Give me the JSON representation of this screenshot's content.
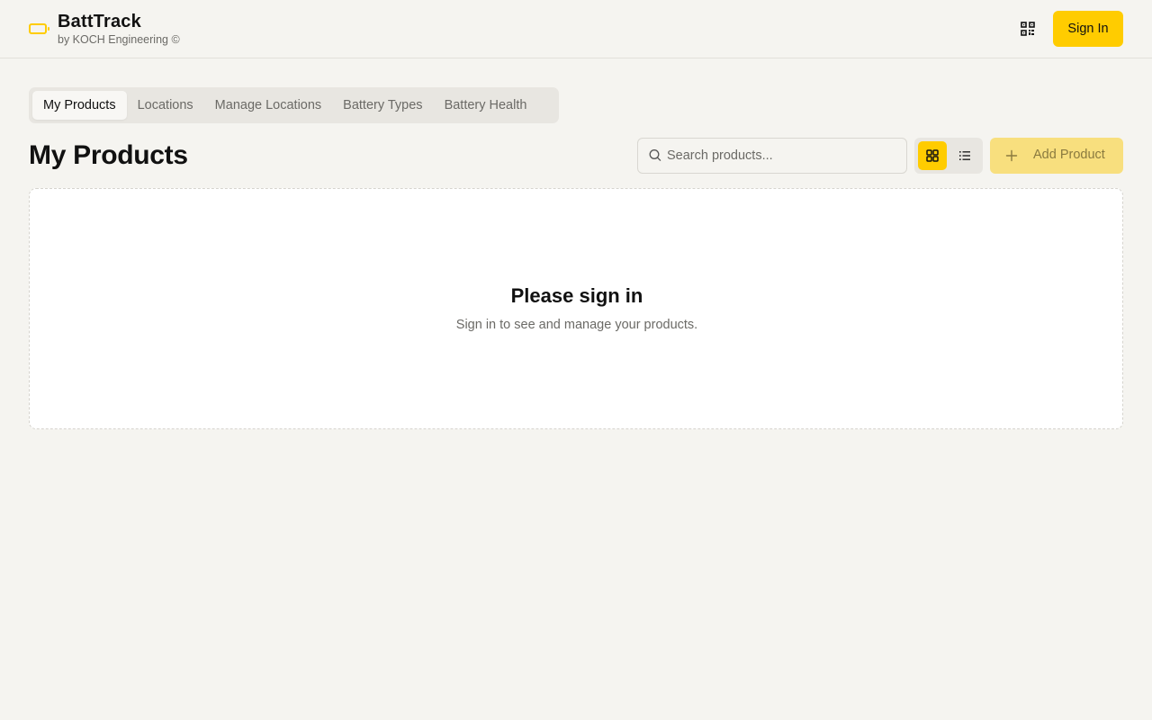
{
  "app": {
    "title": "BattTrack",
    "subtitle": "by KOCH Engineering ©",
    "accent_color": "#ffcc00"
  },
  "header": {
    "qr_icon": "qr-code-icon",
    "signin_label": "Sign In"
  },
  "tabs": [
    {
      "label": "My Products",
      "active": true
    },
    {
      "label": "Locations",
      "active": false
    },
    {
      "label": "Manage Locations",
      "active": false
    },
    {
      "label": "Battery Types",
      "active": false
    },
    {
      "label": "Battery Health",
      "active": false
    }
  ],
  "main": {
    "title": "My Products",
    "search": {
      "placeholder": "Search products...",
      "value": ""
    },
    "view_mode": "grid",
    "add_label": "Add Product",
    "empty": {
      "title": "Please sign in",
      "subtitle": "Sign in to see and manage your products."
    }
  }
}
